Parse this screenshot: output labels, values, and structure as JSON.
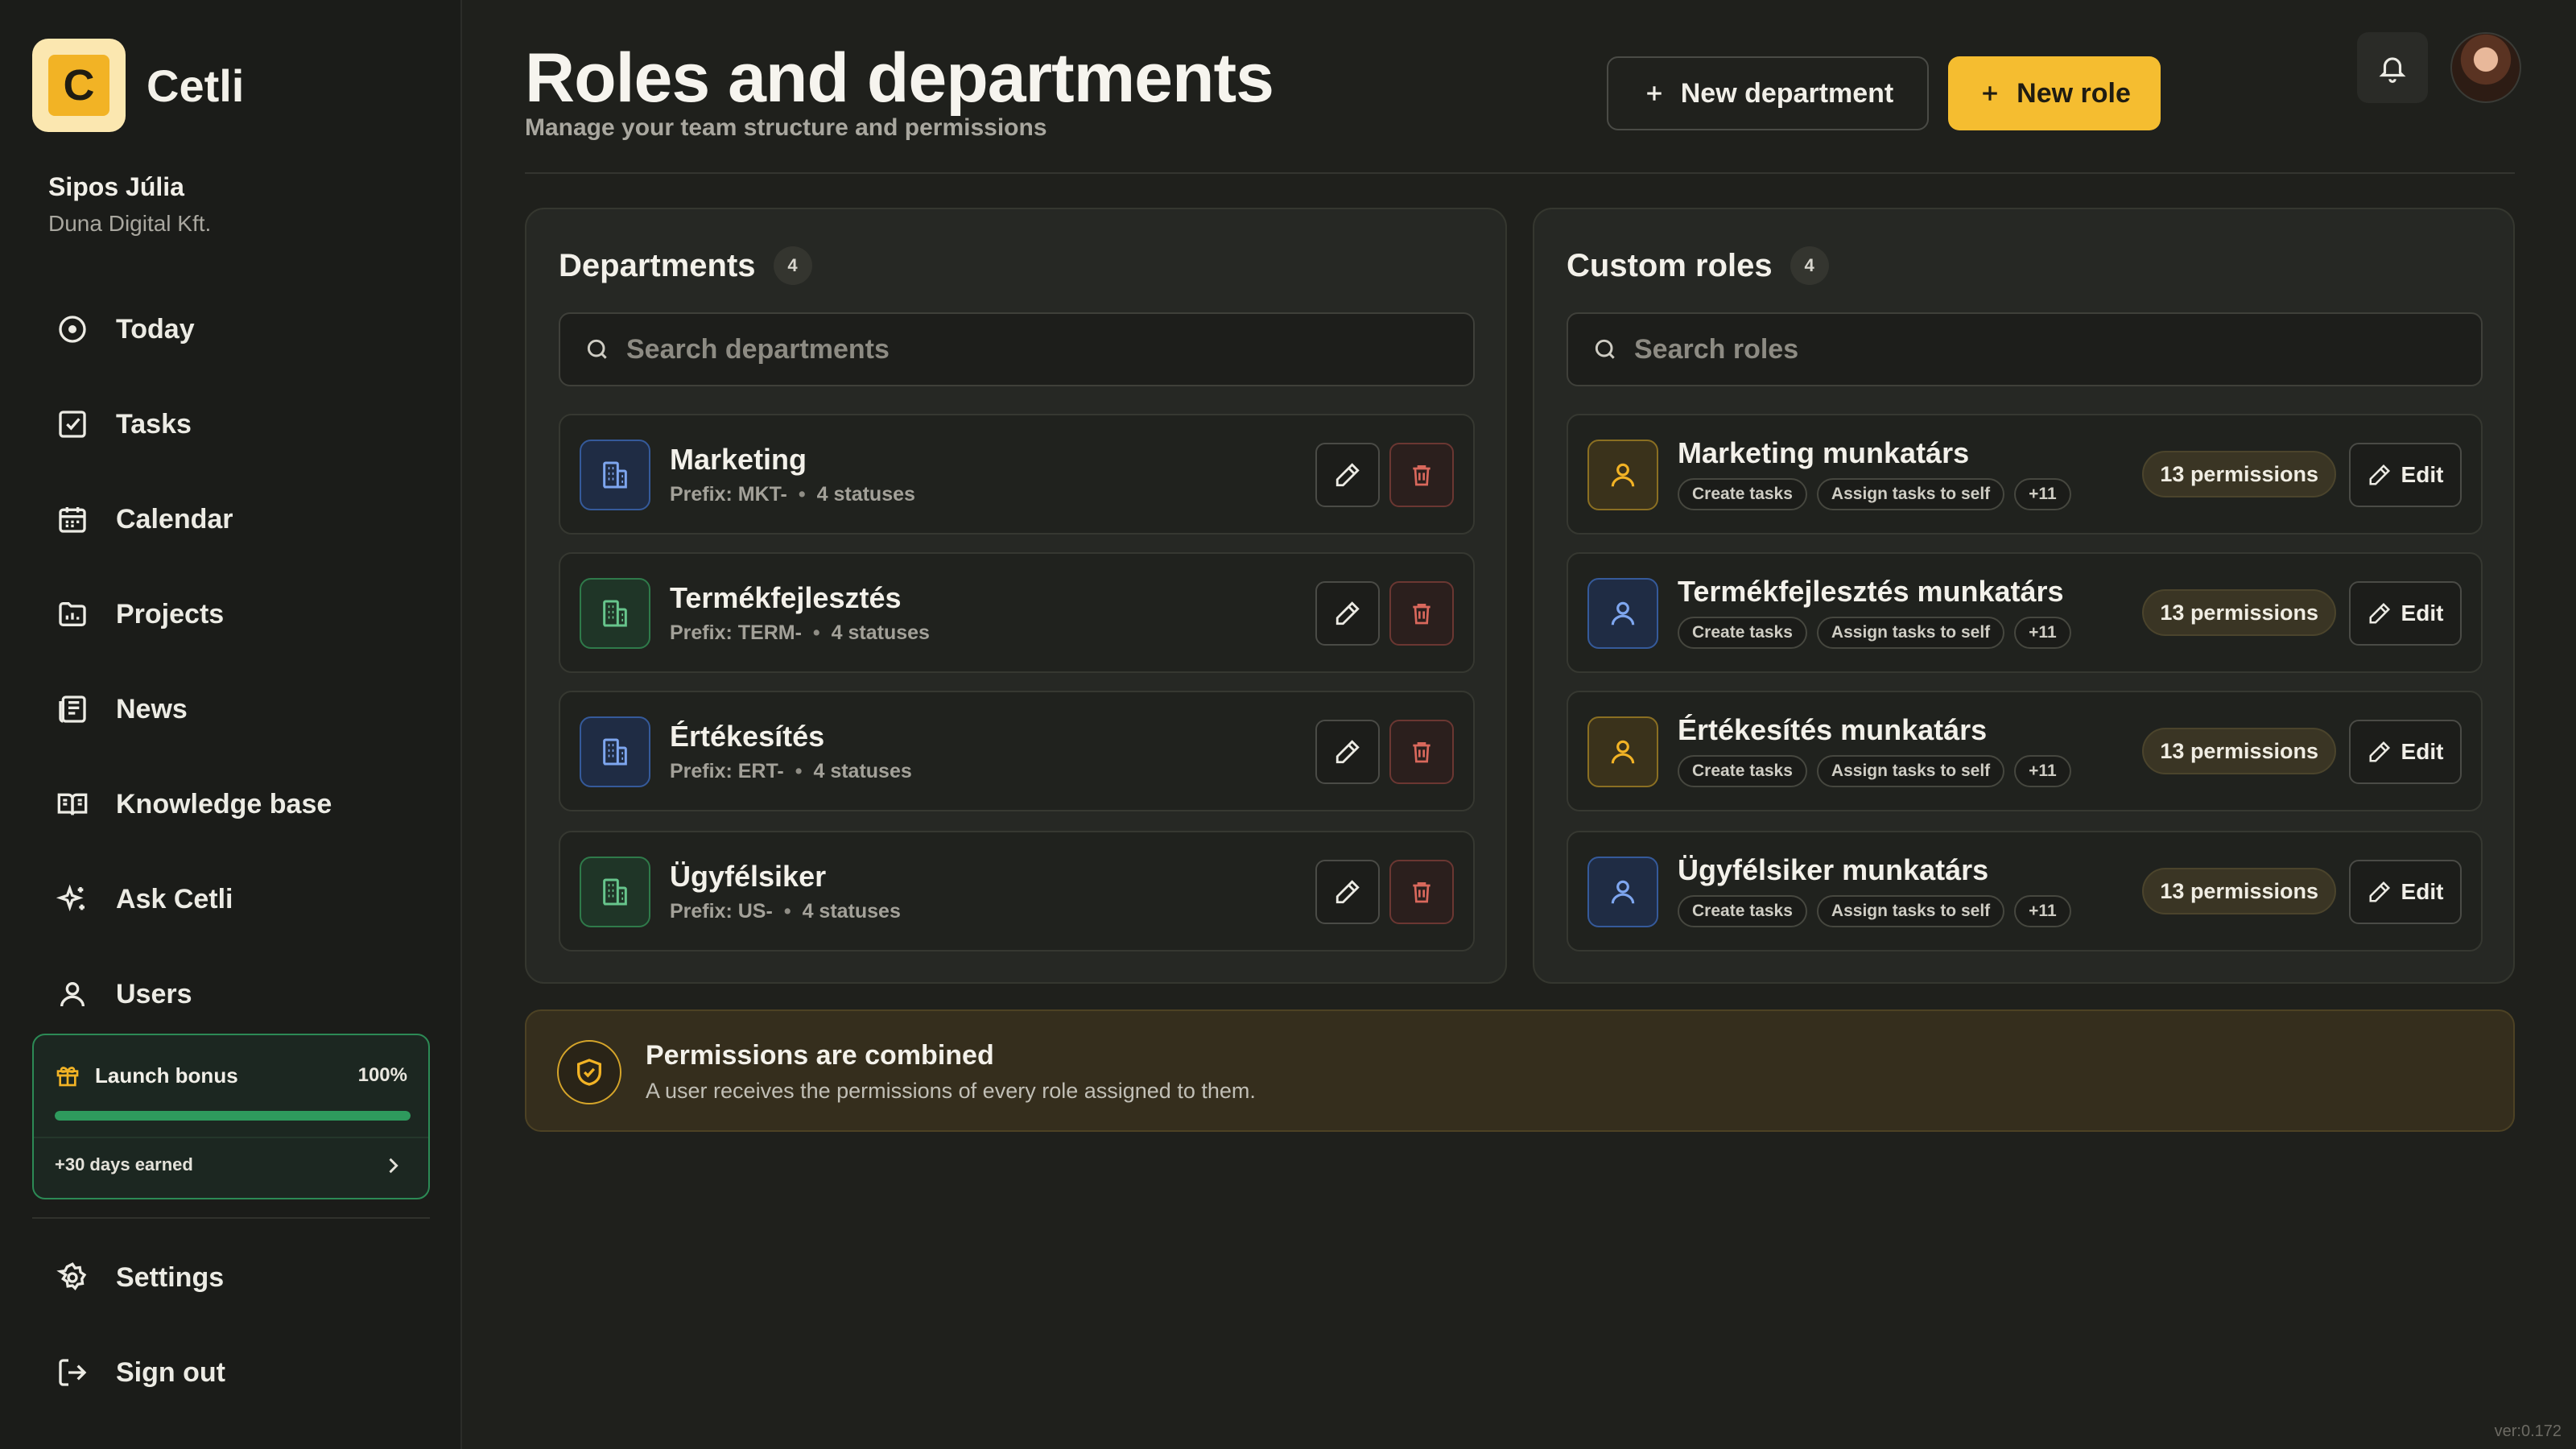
{
  "brand": {
    "name": "Cetli",
    "logo_letter": "C"
  },
  "user": {
    "name": "Sipos Júlia",
    "org": "Duna Digital Kft."
  },
  "nav": {
    "items": [
      {
        "label": "Today",
        "icon": "clock-icon"
      },
      {
        "label": "Tasks",
        "icon": "checkbox-icon"
      },
      {
        "label": "Calendar",
        "icon": "calendar-icon"
      },
      {
        "label": "Projects",
        "icon": "folder-chart-icon"
      },
      {
        "label": "News",
        "icon": "newspaper-icon"
      },
      {
        "label": "Knowledge base",
        "icon": "book-icon"
      },
      {
        "label": "Ask Cetli",
        "icon": "sparkles-icon"
      },
      {
        "label": "Users",
        "icon": "user-icon"
      }
    ],
    "bottom": [
      {
        "label": "Settings",
        "icon": "gear-icon"
      },
      {
        "label": "Sign out",
        "icon": "sign-out-icon"
      }
    ]
  },
  "bonus": {
    "title": "Launch bonus",
    "percent_label": "100%",
    "progress": 1.0,
    "earned": "+30 days earned"
  },
  "header": {
    "title": "Roles and departments",
    "subtitle": "Manage your team structure and permissions",
    "new_department": "New department",
    "new_role": "New role"
  },
  "departments": {
    "title": "Departments",
    "count": "4",
    "search_placeholder": "Search departments",
    "items": [
      {
        "name": "Marketing",
        "prefix": "Prefix: MKT-",
        "statuses": "4 statuses",
        "color": "blue"
      },
      {
        "name": "Termékfejlesztés",
        "prefix": "Prefix: TERM-",
        "statuses": "4 statuses",
        "color": "green"
      },
      {
        "name": "Értékesítés",
        "prefix": "Prefix: ERT-",
        "statuses": "4 statuses",
        "color": "blue"
      },
      {
        "name": "Ügyfélsiker",
        "prefix": "Prefix: US-",
        "statuses": "4 statuses",
        "color": "green"
      }
    ]
  },
  "roles": {
    "title": "Custom roles",
    "count": "4",
    "search_placeholder": "Search roles",
    "edit_label": "Edit",
    "items": [
      {
        "name": "Marketing munkatárs",
        "chips": [
          "Create tasks",
          "Assign tasks to self",
          "+11"
        ],
        "permissions": "13 permissions",
        "color": "gold"
      },
      {
        "name": "Termékfejlesztés munkatárs",
        "chips": [
          "Create tasks",
          "Assign tasks to self",
          "+11"
        ],
        "permissions": "13 permissions",
        "color": "blue"
      },
      {
        "name": "Értékesítés munkatárs",
        "chips": [
          "Create tasks",
          "Assign tasks to self",
          "+11"
        ],
        "permissions": "13 permissions",
        "color": "gold"
      },
      {
        "name": "Ügyfélsiker munkatárs",
        "chips": [
          "Create tasks",
          "Assign tasks to self",
          "+11"
        ],
        "permissions": "13 permissions",
        "color": "blue"
      }
    ]
  },
  "info": {
    "title": "Permissions are combined",
    "text": "A user receives the permissions of every role assigned to them."
  },
  "version": "ver:0.172",
  "colors": {
    "accent": "#f5bd30",
    "success": "#2e9a5d",
    "danger": "#d9685c",
    "blue": "#6f9de8",
    "green": "#5fbf83"
  }
}
